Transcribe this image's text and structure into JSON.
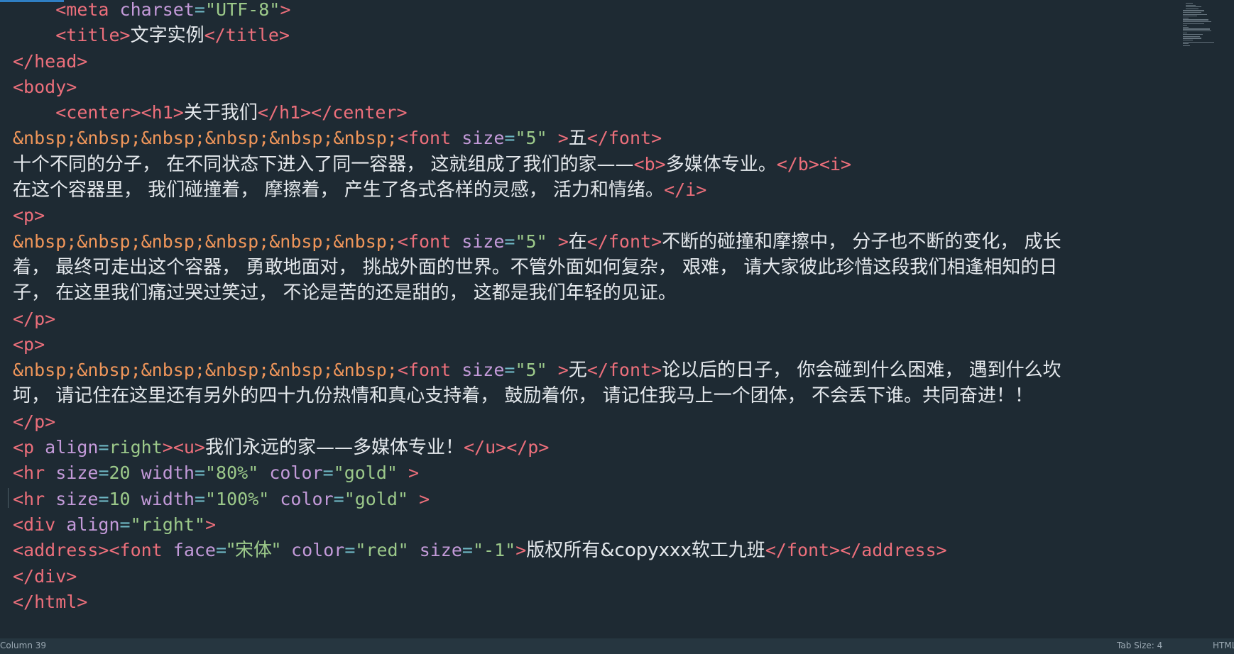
{
  "editor": {
    "lines": [
      [
        {
          "c": "txt",
          "t": "    "
        },
        {
          "c": "tag",
          "t": "<meta"
        },
        {
          "c": "txt",
          "t": " "
        },
        {
          "c": "attr",
          "t": "charset"
        },
        {
          "c": "eq",
          "t": "="
        },
        {
          "c": "str",
          "t": "\"UTF-8\""
        },
        {
          "c": "tag",
          "t": ">"
        }
      ],
      [
        {
          "c": "txt",
          "t": "    "
        },
        {
          "c": "tag",
          "t": "<title>"
        },
        {
          "c": "txt cn",
          "t": "文字实例"
        },
        {
          "c": "tag",
          "t": "</title>"
        }
      ],
      [
        {
          "c": "tag",
          "t": "</head>"
        }
      ],
      [
        {
          "c": "tag",
          "t": "<body>"
        }
      ],
      [
        {
          "c": "txt",
          "t": "    "
        },
        {
          "c": "tag",
          "t": "<center><h1>"
        },
        {
          "c": "txt cn",
          "t": "关于我们"
        },
        {
          "c": "tag",
          "t": "</h1></center>"
        }
      ],
      [
        {
          "c": "ent",
          "t": "&nbsp;&nbsp;&nbsp;&nbsp;&nbsp;&nbsp;"
        },
        {
          "c": "tag",
          "t": "<font"
        },
        {
          "c": "txt",
          "t": " "
        },
        {
          "c": "attr",
          "t": "size"
        },
        {
          "c": "eq",
          "t": "="
        },
        {
          "c": "str",
          "t": "\"5\""
        },
        {
          "c": "txt",
          "t": " "
        },
        {
          "c": "tag",
          "t": ">"
        },
        {
          "c": "txt cn",
          "t": "五"
        },
        {
          "c": "tag",
          "t": "</font>"
        }
      ],
      [
        {
          "c": "txt cn",
          "t": "十个不同的分子， 在不同状态下进入了同一容器， 这就组成了我们的家——"
        },
        {
          "c": "tag",
          "t": "<b>"
        },
        {
          "c": "txt cn",
          "t": "多媒体专业。"
        },
        {
          "c": "tag",
          "t": "</b><i>"
        }
      ],
      [
        {
          "c": "txt cn",
          "t": "在这个容器里， 我们碰撞着， 摩擦着， 产生了各式各样的灵感， 活力和情绪。"
        },
        {
          "c": "tag",
          "t": "</i>"
        }
      ],
      [
        {
          "c": "tag",
          "t": "<p>"
        }
      ],
      [
        {
          "c": "ent",
          "t": "&nbsp;&nbsp;&nbsp;&nbsp;&nbsp;&nbsp;"
        },
        {
          "c": "tag",
          "t": "<font"
        },
        {
          "c": "txt",
          "t": " "
        },
        {
          "c": "attr",
          "t": "size"
        },
        {
          "c": "eq",
          "t": "="
        },
        {
          "c": "str",
          "t": "\"5\""
        },
        {
          "c": "txt",
          "t": " "
        },
        {
          "c": "tag",
          "t": ">"
        },
        {
          "c": "txt cn",
          "t": "在"
        },
        {
          "c": "tag",
          "t": "</font>"
        },
        {
          "c": "txt cn",
          "t": "不断的碰撞和摩擦中， 分子也不断的变化， 成长"
        }
      ],
      [
        {
          "c": "txt cn",
          "t": "着， 最终可走出这个容器， 勇敢地面对， 挑战外面的世界。不管外面如何复杂， 艰难， 请大家彼此珍惜这段我们相逢相知的日"
        }
      ],
      [
        {
          "c": "txt cn",
          "t": "子， 在这里我们痛过哭过笑过， 不论是苦的还是甜的， 这都是我们年轻的见证。"
        }
      ],
      [
        {
          "c": "tag",
          "t": "</p>"
        }
      ],
      [
        {
          "c": "tag",
          "t": "<p>"
        }
      ],
      [
        {
          "c": "ent",
          "t": "&nbsp;&nbsp;&nbsp;&nbsp;&nbsp;&nbsp;"
        },
        {
          "c": "tag",
          "t": "<font"
        },
        {
          "c": "txt",
          "t": " "
        },
        {
          "c": "attr",
          "t": "size"
        },
        {
          "c": "eq",
          "t": "="
        },
        {
          "c": "str",
          "t": "\"5\""
        },
        {
          "c": "txt",
          "t": " "
        },
        {
          "c": "tag",
          "t": ">"
        },
        {
          "c": "txt cn",
          "t": "无"
        },
        {
          "c": "tag",
          "t": "</font>"
        },
        {
          "c": "txt cn",
          "t": "论以后的日子， 你会碰到什么困难， 遇到什么坎"
        }
      ],
      [
        {
          "c": "txt cn",
          "t": "坷， 请记住在这里还有另外的四十九份热情和真心支持着， 鼓励着你， 请记住我马上一个团体， 不会丢下谁。共同奋进！！"
        }
      ],
      [
        {
          "c": "tag",
          "t": "</p>"
        }
      ],
      [
        {
          "c": "tag",
          "t": "<p"
        },
        {
          "c": "txt",
          "t": " "
        },
        {
          "c": "attr",
          "t": "align"
        },
        {
          "c": "eq",
          "t": "="
        },
        {
          "c": "str",
          "t": "right"
        },
        {
          "c": "tag",
          "t": "><u>"
        },
        {
          "c": "txt cn",
          "t": "我们永远的家——多媒体专业！"
        },
        {
          "c": "tag",
          "t": "</u></p>"
        }
      ],
      [
        {
          "c": "tag",
          "t": "<hr"
        },
        {
          "c": "txt",
          "t": " "
        },
        {
          "c": "attr",
          "t": "size"
        },
        {
          "c": "eq",
          "t": "="
        },
        {
          "c": "str",
          "t": "20"
        },
        {
          "c": "txt",
          "t": " "
        },
        {
          "c": "attr",
          "t": "width"
        },
        {
          "c": "eq",
          "t": "="
        },
        {
          "c": "str",
          "t": "\"80%\""
        },
        {
          "c": "txt",
          "t": " "
        },
        {
          "c": "attr",
          "t": "color"
        },
        {
          "c": "eq",
          "t": "="
        },
        {
          "c": "str",
          "t": "\"gold\""
        },
        {
          "c": "txt",
          "t": " "
        },
        {
          "c": "tag",
          "t": ">"
        }
      ],
      [
        {
          "c": "tag",
          "t": "<hr"
        },
        {
          "c": "txt",
          "t": " "
        },
        {
          "c": "attr",
          "t": "size"
        },
        {
          "c": "eq",
          "t": "="
        },
        {
          "c": "str",
          "t": "10"
        },
        {
          "c": "txt",
          "t": " "
        },
        {
          "c": "attr",
          "t": "width"
        },
        {
          "c": "eq",
          "t": "="
        },
        {
          "c": "str",
          "t": "\"100%\""
        },
        {
          "c": "txt",
          "t": " "
        },
        {
          "c": "attr",
          "t": "color"
        },
        {
          "c": "eq",
          "t": "="
        },
        {
          "c": "str",
          "t": "\"gold\""
        },
        {
          "c": "txt",
          "t": " "
        },
        {
          "c": "tag",
          "t": ">"
        }
      ],
      [
        {
          "c": "tag",
          "t": "<div"
        },
        {
          "c": "txt",
          "t": " "
        },
        {
          "c": "attr",
          "t": "align"
        },
        {
          "c": "eq",
          "t": "="
        },
        {
          "c": "str",
          "t": "\"right\""
        },
        {
          "c": "tag",
          "t": ">"
        }
      ],
      [
        {
          "c": "tag",
          "t": "<address><font"
        },
        {
          "c": "txt",
          "t": " "
        },
        {
          "c": "attr",
          "t": "face"
        },
        {
          "c": "eq",
          "t": "="
        },
        {
          "c": "str cn",
          "t": "\"宋体\""
        },
        {
          "c": "txt",
          "t": " "
        },
        {
          "c": "attr",
          "t": "color"
        },
        {
          "c": "eq",
          "t": "="
        },
        {
          "c": "str",
          "t": "\"red\""
        },
        {
          "c": "txt",
          "t": " "
        },
        {
          "c": "attr",
          "t": "size"
        },
        {
          "c": "eq",
          "t": "="
        },
        {
          "c": "str",
          "t": "\"-1\""
        },
        {
          "c": "tag",
          "t": ">"
        },
        {
          "c": "txt cn",
          "t": "版权所有&copyxxx软工九班"
        },
        {
          "c": "tag",
          "t": "</font></address>"
        }
      ],
      [
        {
          "c": "tag",
          "t": "</div>"
        }
      ],
      [
        {
          "c": "tag",
          "t": "</html>"
        }
      ]
    ]
  },
  "status_bar": {
    "position": "Column 39",
    "tab_size": "Tab Size: 4",
    "syntax": "HTML"
  },
  "colors": {
    "background": "#1e2a33",
    "tag": "#ec6f7b",
    "attribute": "#c39ad9",
    "string": "#9cc98a",
    "entity": "#f0965a",
    "text": "#e4e8ec"
  }
}
